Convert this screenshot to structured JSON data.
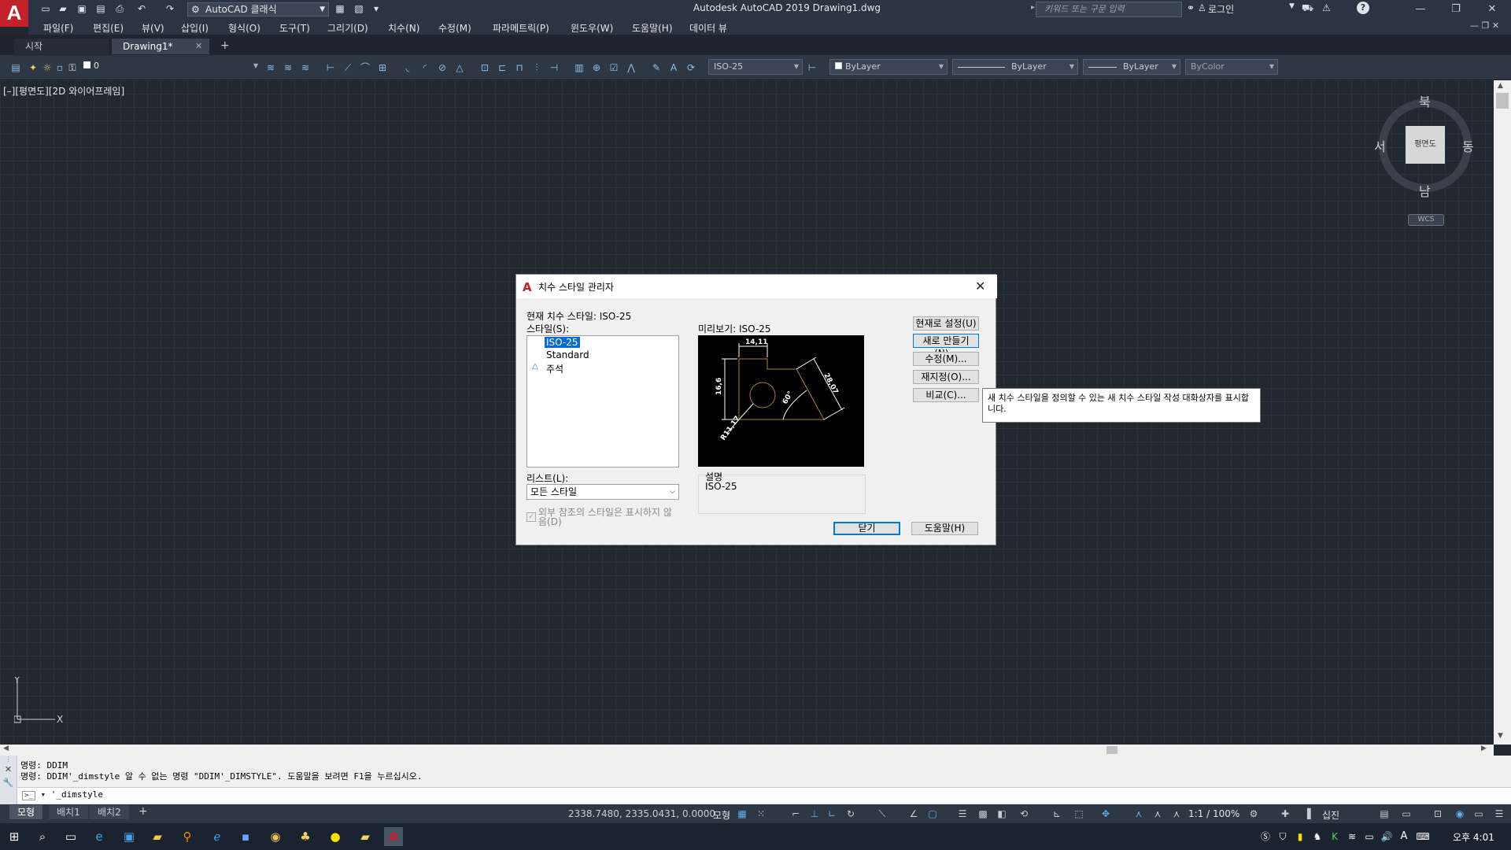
{
  "window": {
    "title": "Autodesk AutoCAD 2019    Drawing1.dwg",
    "workspace": "AutoCAD 클래식",
    "search_placeholder": "키워드 또는 구문 입력",
    "login": "로그인"
  },
  "menu": [
    "파일(F)",
    "편집(E)",
    "뷰(V)",
    "삽입(I)",
    "형식(O)",
    "도구(T)",
    "그리기(D)",
    "치수(N)",
    "수정(M)",
    "파라메트릭(P)",
    "윈도우(W)",
    "도움말(H)",
    "데이터 뷰"
  ],
  "tabs": [
    "시작",
    "Drawing1*"
  ],
  "toolbar": {
    "layer_value": "0",
    "dimstyle": "ISO-25",
    "color": "ByLayer",
    "linetype": "ByLayer",
    "lineweight": "ByLayer",
    "plotstyle": "ByColor"
  },
  "viewport": {
    "label": "[–][평면도][2D 와이어프레임]",
    "cube_face": "평면도",
    "north": "북",
    "south": "남",
    "east": "동",
    "west": "서",
    "wcs": "WCS",
    "ucs_x": "X",
    "ucs_y": "Y"
  },
  "dialog": {
    "title": "치수 스타일 관리자",
    "current_style": "현재 치수 스타일: ISO-25",
    "styles_label": "스타일(S):",
    "styles": [
      "ISO-25",
      "Standard",
      "주석"
    ],
    "preview_label": "미리보기: ISO-25",
    "preview_dims": [
      "14,11",
      "16,6",
      "28,07",
      "60°",
      "R11,17"
    ],
    "list_label": "리스트(L):",
    "list_value": "모든 스타일",
    "xref_label": "외부 참조의 스타일은 표시하지 않음(D)",
    "desc_label": "설명",
    "desc_value": "ISO-25",
    "buttons": {
      "set_current": "현재로 설정(U)",
      "new": "새로 만들기(N)...",
      "modify": "수정(M)...",
      "override": "재지정(O)...",
      "compare": "비교(C)...",
      "close": "닫기",
      "help": "도움말(H)"
    },
    "tooltip": "새 치수 스타일을 정의할 수 있는 새 치수 스타일 작성 대화상자를 표시합니다."
  },
  "command": {
    "history": [
      "명령: DDIM",
      "명령: DDIM'_dimstyle 알 수 없는 명령 \"DDIM'_DIMSTYLE\".  도움말을 보려면 F1을 누르십시오."
    ],
    "input": "'_dimstyle"
  },
  "layout_tabs": [
    "모형",
    "배치1",
    "배치2"
  ],
  "status": {
    "coords": "2338.7480, 2335.0431, 0.0000",
    "model": "모형",
    "scale": "1:1 / 100%",
    "units": "십진"
  },
  "taskbar": {
    "clock": "오후 4:01",
    "ime": "A"
  },
  "colors": {
    "accent": "#0078d7",
    "logo": "#c4222a",
    "canvas": "#212830"
  }
}
